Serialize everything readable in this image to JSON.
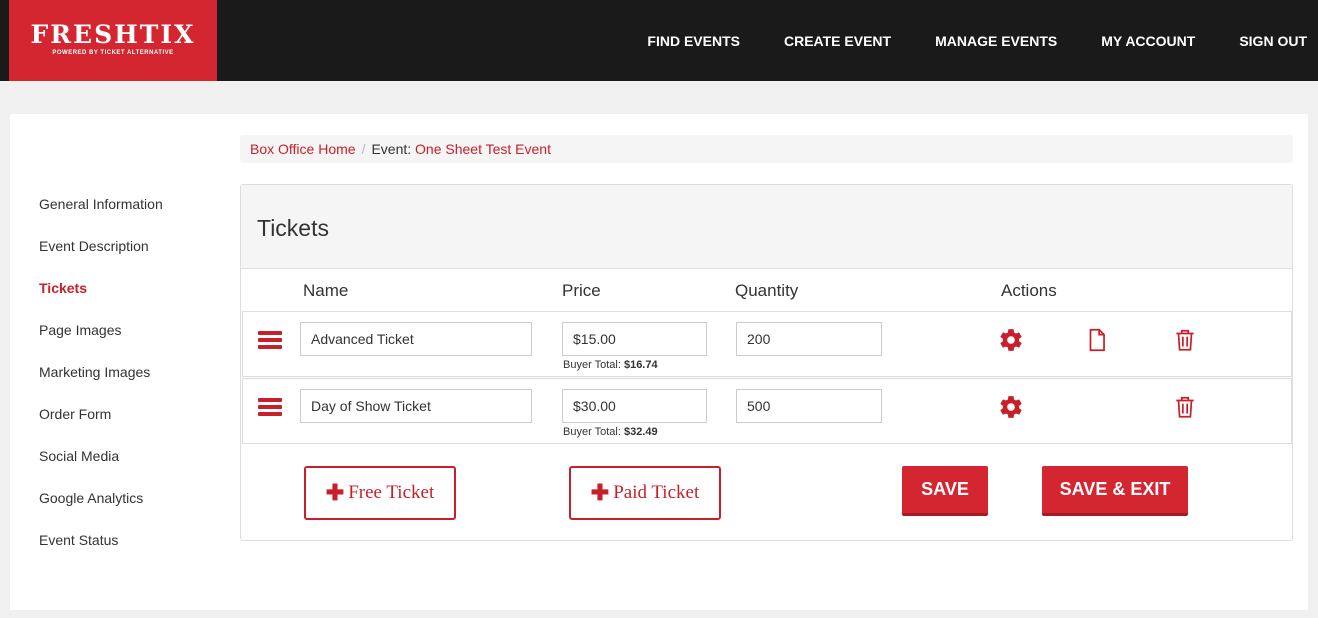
{
  "logo": {
    "brand": "FRESHTIX",
    "tagline": "POWERED BY TICKET ALTERNATIVE"
  },
  "nav": [
    "FIND EVENTS",
    "CREATE EVENT",
    "MANAGE EVENTS",
    "MY ACCOUNT",
    "SIGN OUT"
  ],
  "sidebar": {
    "items": [
      "General Information",
      "Event Description",
      "Tickets",
      "Page Images",
      "Marketing Images",
      "Order Form",
      "Social Media",
      "Google Analytics",
      "Event Status"
    ],
    "active": "Tickets"
  },
  "breadcrumb": {
    "home": "Box Office Home",
    "sep": "/",
    "event_prefix": "Event:",
    "event_name": "One Sheet Test Event"
  },
  "tickets": {
    "title": "Tickets",
    "columns": {
      "name": "Name",
      "price": "Price",
      "quantity": "Quantity",
      "actions": "Actions"
    },
    "rows": [
      {
        "name": "Advanced Ticket",
        "price": "$15.00",
        "buyer_label": "Buyer Total:",
        "buyer_total": "$16.74",
        "quantity": "200"
      },
      {
        "name": "Day of Show Ticket",
        "price": "$30.00",
        "buyer_label": "Buyer Total:",
        "buyer_total": "$32.49",
        "quantity": "500"
      }
    ],
    "buttons": {
      "free": "Free Ticket",
      "paid": "Paid Ticket",
      "save": "SAVE",
      "save_exit": "SAVE & EXIT"
    }
  },
  "icons": {
    "drag": "hamburger-icon",
    "settings": "gear-icon",
    "document": "document-icon",
    "delete": "trash-icon",
    "add": "plus-icon"
  },
  "colors": {
    "accent": "#d42630",
    "header_bg": "#1a1a1a"
  }
}
